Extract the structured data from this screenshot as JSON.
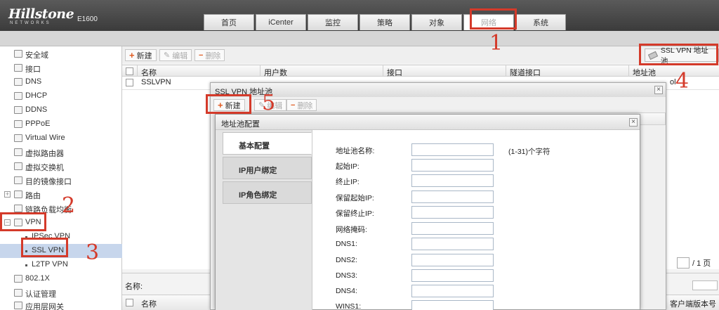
{
  "header": {
    "logo": "Hillstone",
    "logo_sub": "NETWORKS",
    "model": "E1600",
    "tabs": [
      "首页",
      "iCenter",
      "监控",
      "策略",
      "对象",
      "网络",
      "系统"
    ],
    "active_tab": "网络"
  },
  "sidebar": {
    "items": [
      {
        "label": "安全域"
      },
      {
        "label": "接口"
      },
      {
        "label": "DNS"
      },
      {
        "label": "DHCP"
      },
      {
        "label": "DDNS"
      },
      {
        "label": "PPPoE"
      },
      {
        "label": "Virtual Wire"
      },
      {
        "label": "虚拟路由器"
      },
      {
        "label": "虚拟交换机"
      },
      {
        "label": "目的镜像接口"
      },
      {
        "label": "路由"
      },
      {
        "label": "链路负载均衡"
      },
      {
        "label": "VPN"
      },
      {
        "label": "IPSec VPN"
      },
      {
        "label": "SSL VPN"
      },
      {
        "label": "L2TP VPN"
      },
      {
        "label": "802.1X"
      },
      {
        "label": "认证管理"
      },
      {
        "label": "应用层网关"
      }
    ],
    "tree_toggle": "+",
    "vpn_toggle": "−"
  },
  "main_toolbar": {
    "new": "新建",
    "edit": "编辑",
    "delete": "删除",
    "pool_button": "SSL VPN 地址池"
  },
  "main_table": {
    "columns": [
      "名称",
      "用户数",
      "接口",
      "隧道接口",
      "地址池"
    ],
    "rows": [
      {
        "name": "SSLVPN",
        "pool_fragment": "ol"
      }
    ]
  },
  "pager": {
    "text": "/ 1 页"
  },
  "bottom_panel": {
    "name_label": "名称:",
    "col_name": "名称",
    "col_version": "客户端版本号"
  },
  "pool_dialog": {
    "title": "SSL VPN 地址池",
    "new": "新建",
    "edit": "编辑",
    "delete": "删除",
    "close": "×"
  },
  "config_dialog": {
    "title": "地址池配置",
    "close": "×",
    "tabs": [
      "基本配置",
      "IP用户绑定",
      "IP角色绑定"
    ],
    "fields": [
      {
        "label": "地址池名称:",
        "value": "",
        "hint": "(1-31)个字符"
      },
      {
        "label": "起始IP:",
        "value": ""
      },
      {
        "label": "终止IP:",
        "value": ""
      },
      {
        "label": "保留起始IP:",
        "value": ""
      },
      {
        "label": "保留终止IP:",
        "value": ""
      },
      {
        "label": "网络掩码:",
        "value": ""
      },
      {
        "label": "DNS1:",
        "value": ""
      },
      {
        "label": "DNS2:",
        "value": ""
      },
      {
        "label": "DNS3:",
        "value": ""
      },
      {
        "label": "DNS4:",
        "value": ""
      },
      {
        "label": "WINS1:",
        "value": ""
      }
    ]
  },
  "annotations": [
    "1",
    "2",
    "3",
    "4",
    "5"
  ],
  "colors": {
    "annotation_red": "#d43a2a",
    "selected_row": "#c7d6ec"
  }
}
